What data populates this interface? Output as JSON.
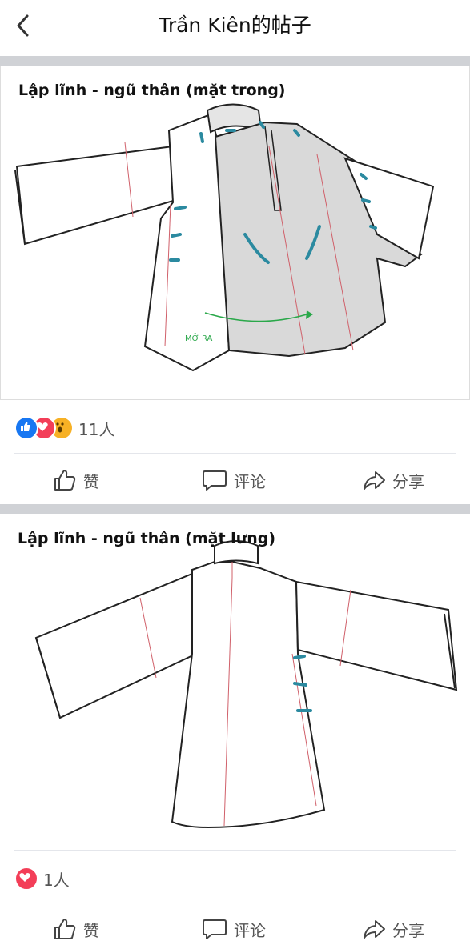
{
  "header": {
    "title": "Trần Kiên的帖子"
  },
  "posts": [
    {
      "caption": "Lập lĩnh - ngũ thân (mặt trong)",
      "annotation": "MỞ RA",
      "reaction_count": "11人",
      "reactions": [
        "like",
        "love",
        "wow"
      ]
    },
    {
      "caption": "Lập lĩnh - ngũ thân (mặt lưng)",
      "reaction_count": "1人",
      "reactions": [
        "love"
      ]
    }
  ],
  "actions": {
    "like": "赞",
    "comment": "评论",
    "share": "分享"
  },
  "colors": {
    "like": "#1877f2",
    "love": "#f33e58",
    "wow": "#f7b125",
    "separator": "#d0d2d6",
    "lining": "#d9d9d9",
    "fastener": "#2b8aa0",
    "seam": "#d0606a",
    "arrow": "#2aa84a"
  }
}
